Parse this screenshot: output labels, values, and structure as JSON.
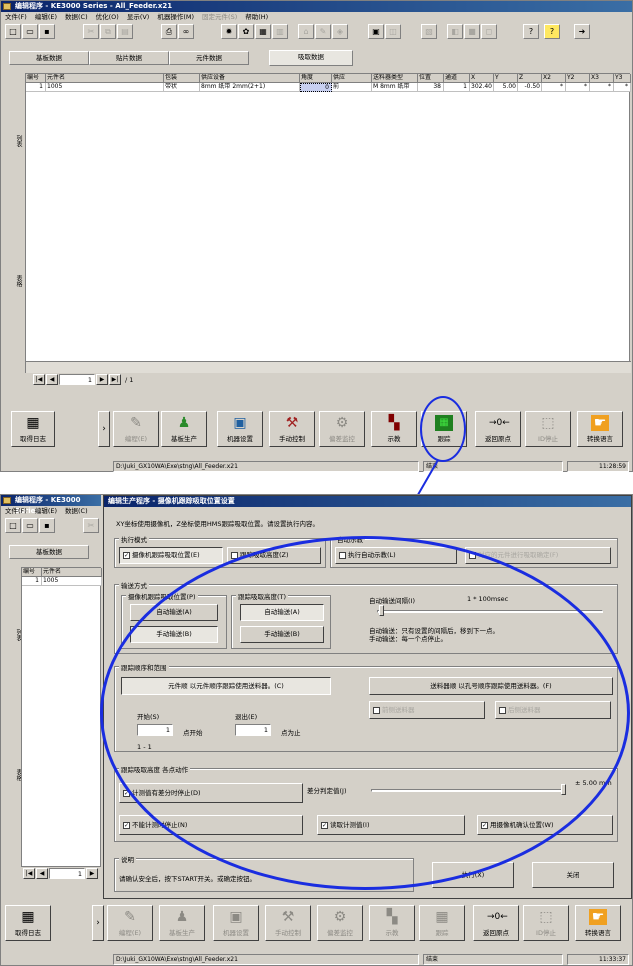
{
  "top": {
    "title": "编辑程序 - KE3000 Series - All_Feeder.x21",
    "menu": [
      "文件(F)",
      "编辑(E)",
      "数据(C)",
      "优化(O)",
      "显示(V)",
      "机器操作(M)",
      "固定元件(S)",
      "帮助(H)"
    ],
    "tabs": [
      "基板数据",
      "贴片数据",
      "元件数据",
      "吸取数据"
    ],
    "grid": {
      "headers": [
        "编号",
        "元件名",
        "包装",
        "供应设备",
        "角度",
        "供应",
        "送料器类型",
        "位置",
        "通道",
        "X",
        "Y",
        "Z",
        "X2",
        "Y2",
        "X3",
        "Y3"
      ],
      "row": [
        "1",
        "1005",
        "带状",
        "8mm 纸带 2mm(2+1)",
        "0",
        "前",
        "M 8mm 纸带",
        "38",
        "1",
        "302.40",
        "5.00",
        "-0.50",
        "*",
        "*",
        "*",
        "*"
      ]
    },
    "side_labels": [
      "列表",
      "表格"
    ],
    "nav": {
      "page": "1",
      "total": "1"
    },
    "buttons": [
      "取得日志",
      "编程(E)",
      "基板生产",
      "机器设置",
      "手动控制",
      "偏差监控",
      "示教",
      "跟踪",
      "返回原点",
      "ID停止",
      "转换语言"
    ],
    "status": {
      "path": "D:\\Juki_GX10WA\\Exe\\stng\\All_Feeder.x21",
      "state": "结束",
      "time": "11:28:59"
    }
  },
  "bottom": {
    "title": "编辑程序 - KE3000 Series",
    "dialog_title": "编辑生产程序 - 摄像机跟踪吸取位置设置",
    "menu": [
      "文件(F)",
      "编辑(E)",
      "数据(C)"
    ],
    "tab": "基板数据",
    "grid": {
      "headers": [
        "编号",
        "元件名"
      ],
      "row": [
        "1",
        "1005"
      ]
    },
    "side_labels": [
      "列表",
      "表格"
    ],
    "nav": {
      "page": "1"
    },
    "instruction": "XY坐标使用摄像机，Z坐标使用HMS跟踪吸取位置。请设置执行内容。",
    "mode_group": "执行模式",
    "mode_items": {
      "camera": "摄像机跟踪吸取位置(E)",
      "height": "跟踪吸取高度(Z)"
    },
    "auto_group": "自动示教",
    "auto_items": {
      "run": "执行自动示教(L)",
      "other": "对应的元件进行吸取确定(F)"
    },
    "feed_group": "输送方式",
    "feed_sub1": "摄像机跟踪吸取位置(P)",
    "feed_sub2": "跟踪吸取高度(T)",
    "feed_buttons": {
      "auto1": "自动输送(A)",
      "manual1": "手动输送(B)",
      "auto2": "自动输送(A)",
      "manual2": "手动输送(B)"
    },
    "interval_label": "自动输送间隔(I)",
    "interval_value": "1 * 100msec",
    "interval_note1": "自动输送：只有设置的间隔后，移到下一点。",
    "interval_note2": "手动输送：每一个点停止。",
    "order_group": "跟踪顺序和范围",
    "order_parts": "元件顺 以元件顺序跟踪使用送料器。(C)",
    "order_feeder": "送料器顺 以孔号顺序跟踪使用送料器。(F)",
    "order_front": "前侧送料器",
    "order_rear": "后侧送料器",
    "start_label": "开始(S)",
    "start_value": "1",
    "start_suffix": "点开始",
    "end_label": "退出(E)",
    "end_value": "1",
    "end_suffix": "点为止",
    "range_text": "1 - 1",
    "height_group": "跟踪吸取高度  各点动作",
    "height_items": {
      "stop_if_diff": "计测值有差分时停止(D)",
      "no_stop": "不能计测时停止(N)",
      "repeat": "读取计测值(I)",
      "confirm": "用摄像机确认位置(W)"
    },
    "tolerance_label": "差分判定值(J)",
    "tolerance_value": "± 5.00 mm",
    "note_group": "说明",
    "note_text": "请确认安全后，按下START开关。或确定按钮。",
    "exec_button": "执行(X)",
    "close_button": "关闭",
    "buttons": [
      "取得日志",
      "编程(E)",
      "基板生产",
      "机器设置",
      "手动控制",
      "偏差监控",
      "示教",
      "跟踪",
      "返回原点",
      "ID停止",
      "转换语言"
    ],
    "status": {
      "path": "D:\\Juki_GX10WA\\Exe\\stng\\All_Feeder.x21",
      "state": "结束",
      "time": "11:33:37"
    }
  }
}
